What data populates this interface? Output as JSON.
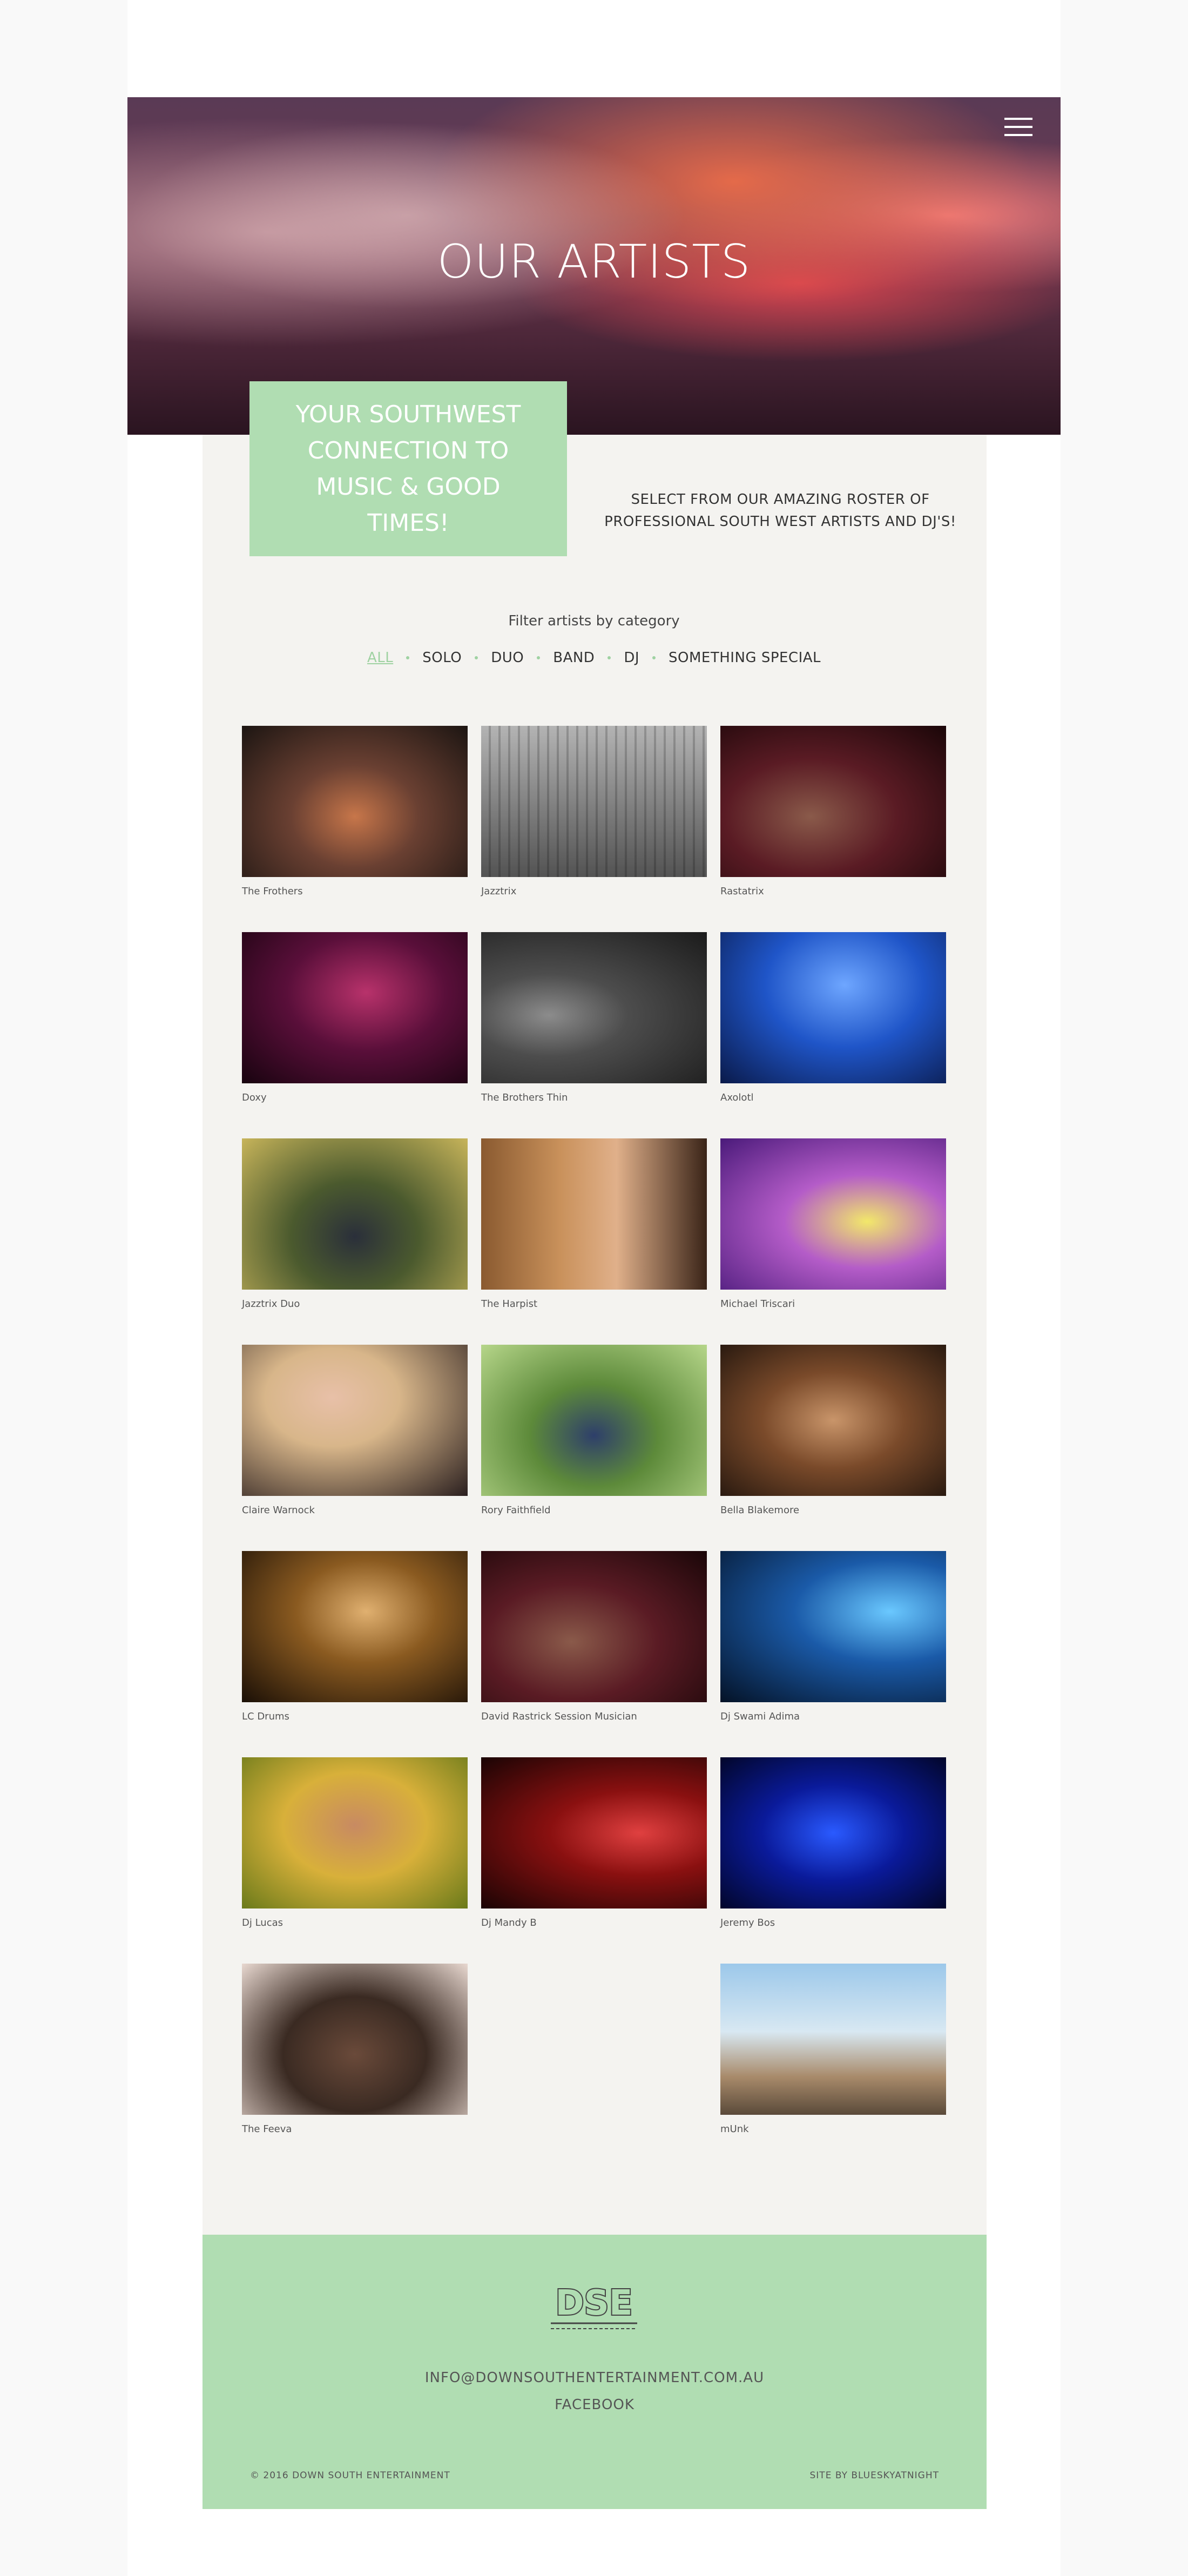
{
  "header": {
    "title": "OUR ARTISTS"
  },
  "intro": {
    "banner": "YOUR SOUTHWEST CONNECTION TO MUSIC & GOOD TIMES!",
    "tagline": "SELECT FROM OUR AMAZING ROSTER OF PROFESSIONAL SOUTH WEST ARTISTS AND DJ'S!"
  },
  "filter": {
    "label": "Filter artists by category",
    "options": [
      "ALL",
      "SOLO",
      "DUO",
      "BAND",
      "DJ",
      "SOMETHING SPECIAL"
    ],
    "active": "ALL"
  },
  "artists": [
    {
      "name": "The Frothers"
    },
    {
      "name": "Jazztrix"
    },
    {
      "name": "Rastatrix"
    },
    {
      "name": "Doxy"
    },
    {
      "name": "The Brothers Thin"
    },
    {
      "name": "Axolotl"
    },
    {
      "name": "Jazztrix Duo"
    },
    {
      "name": "The Harpist"
    },
    {
      "name": "Michael Triscari"
    },
    {
      "name": "Claire Warnock"
    },
    {
      "name": "Rory Faithfield"
    },
    {
      "name": "Bella Blakemore"
    },
    {
      "name": "LC Drums"
    },
    {
      "name": "David Rastrick Session Musician"
    },
    {
      "name": "Dj Swami Adima"
    },
    {
      "name": "Dj Lucas"
    },
    {
      "name": "Dj Mandy B"
    },
    {
      "name": "Jeremy Bos"
    },
    {
      "name": "The Feeva"
    },
    {
      "name": "mUnk"
    }
  ],
  "footer": {
    "logo_text": "DSE",
    "email": "INFO@DOWNSOUTHENTERTAINMENT.COM.AU",
    "facebook": "FACEBOOK",
    "copyright": "© 2016 DOWN SOUTH ENTERTAINMENT",
    "credit": "SITE BY BLUESKYATNIGHT"
  },
  "colors": {
    "accent_green": "#b0ddb2",
    "content_bg": "#f4f3f0",
    "page_bg": "#f9f9f9"
  }
}
